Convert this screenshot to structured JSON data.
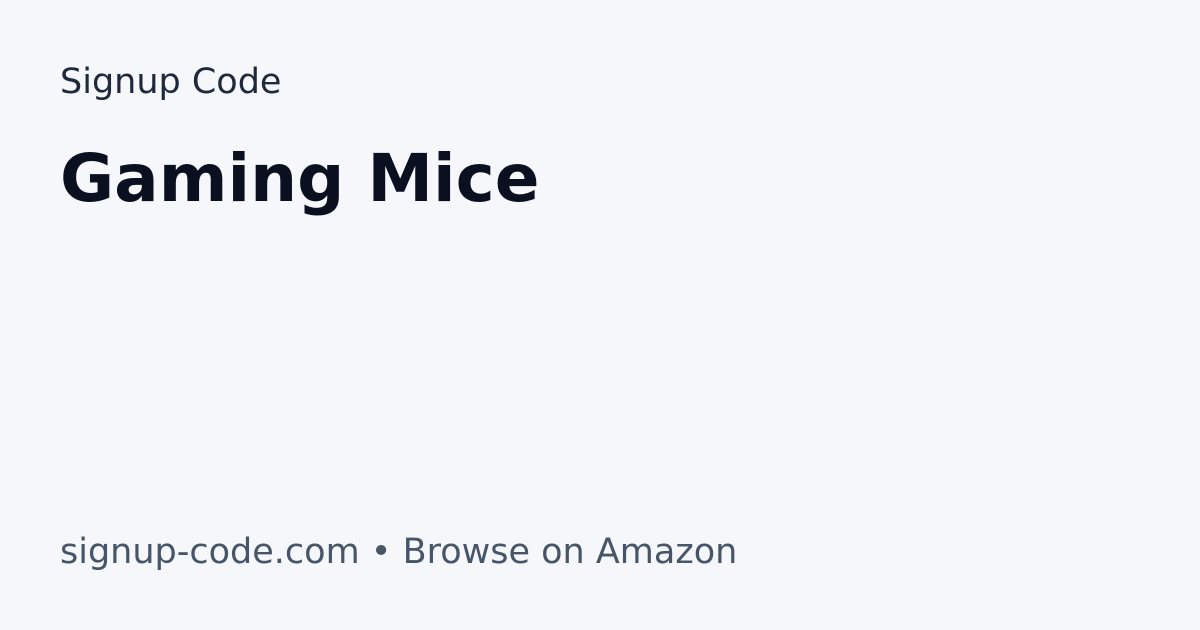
{
  "brand": {
    "name": "Signup Code"
  },
  "page": {
    "title": "Gaming Mice"
  },
  "footer": {
    "text": "signup-code.com • Browse on Amazon"
  },
  "colors": {
    "background": "#f5f7fb",
    "brand_text": "#1e293b",
    "title_text": "#0b1020",
    "footer_text": "#475569"
  }
}
